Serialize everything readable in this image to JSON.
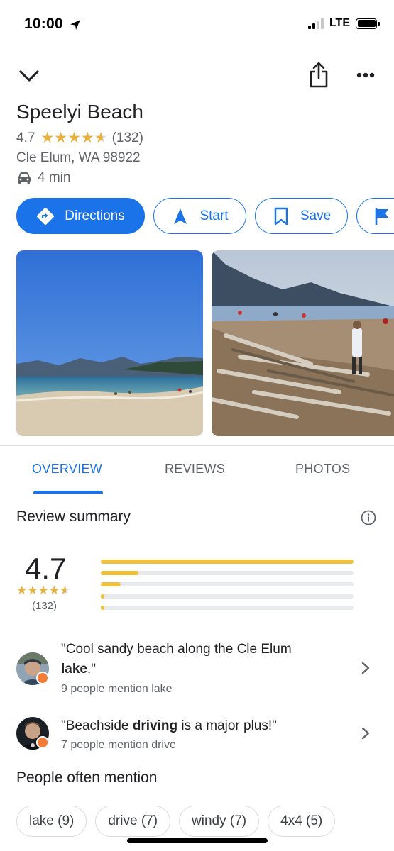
{
  "status_bar": {
    "time": "10:00",
    "network": "LTE"
  },
  "place": {
    "title": "Speelyi Beach",
    "rating": "4.7",
    "review_count": "(132)",
    "address": "Cle Elum, WA 98922",
    "drive_time": "4 min"
  },
  "actions": {
    "directions": "Directions",
    "start": "Start",
    "save": "Save"
  },
  "tabs": {
    "overview": "OVERVIEW",
    "reviews": "REVIEWS",
    "photos": "PHOTOS"
  },
  "review_summary": {
    "title": "Review summary",
    "rating": "4.7",
    "count": "(132)",
    "distribution_percent": [
      100,
      15,
      8,
      1,
      2
    ],
    "quotes": [
      {
        "text_before": "\"Cool sandy beach along the Cle Elum ",
        "keyword": "lake",
        "text_after": ".\"",
        "mention": "9 people mention lake"
      },
      {
        "text_before": "\"Beachside ",
        "keyword": "driving",
        "text_after": " is a major plus!\"",
        "mention": "7 people mention drive"
      }
    ]
  },
  "people_mention": {
    "title": "People often mention",
    "chips": [
      "lake (9)",
      "drive (7)",
      "windy (7)",
      "4x4 (5)"
    ]
  },
  "colors": {
    "accent": "#1a73e8",
    "star": "#e8b03c",
    "bar_fill": "#f2c03b",
    "badge": "#f57c36"
  },
  "icons": {
    "collapse": "chevron-down-icon",
    "share": "share-icon",
    "more": "more-horiz-icon",
    "info": "info-icon"
  }
}
